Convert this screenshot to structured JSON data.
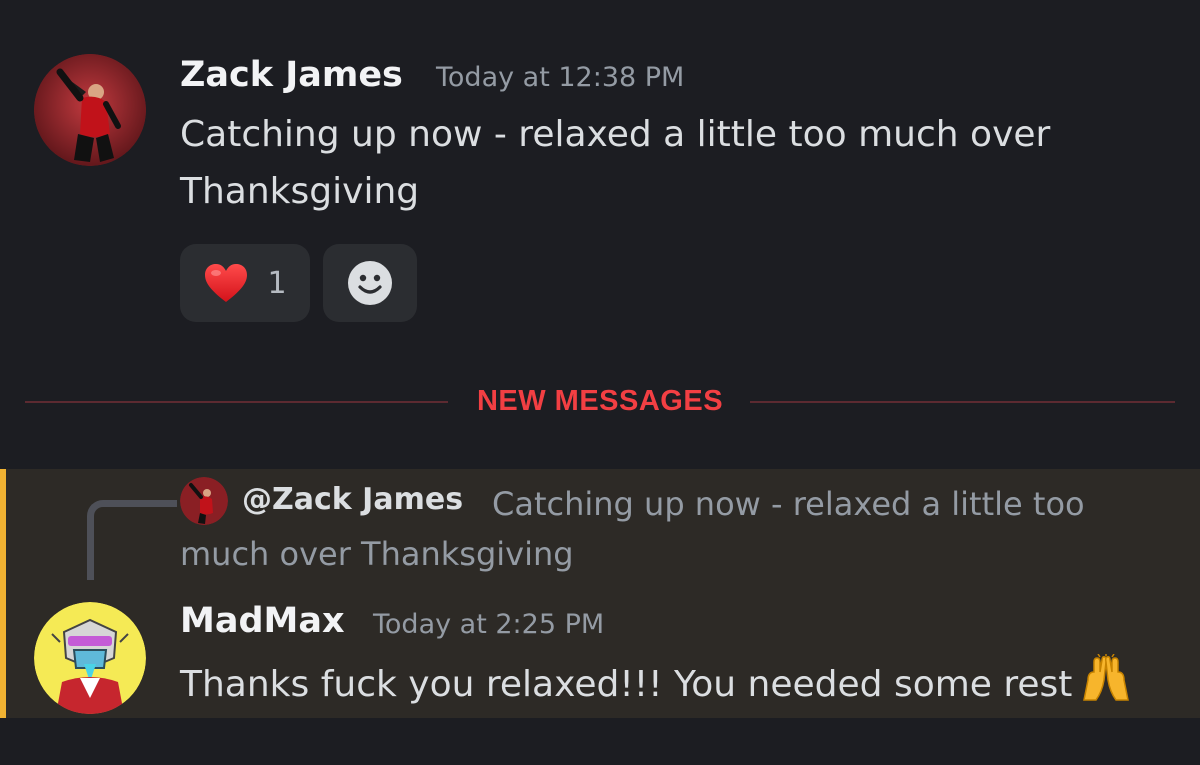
{
  "messages": [
    {
      "author": "Zack James",
      "timestamp": "Today at 12:38 PM",
      "text": "Catching up now - relaxed a little too much over Thanksgiving",
      "reactions": [
        {
          "emoji": "heart",
          "count": "1"
        },
        {
          "emoji": "add-reaction"
        }
      ]
    },
    {
      "author": "MadMax",
      "timestamp": "Today at 2:25 PM",
      "text": "Thanks fuck you relaxed!!! You needed some rest",
      "trailing_emoji": "raising-hands",
      "reply_to": {
        "author": "@Zack James",
        "preview": "Catching up now - relaxed a little too much over Thanksgiving"
      }
    }
  ],
  "divider": {
    "label": "NEW MESSAGES"
  },
  "colors": {
    "background": "#1c1d22",
    "new_messages_red": "#f23f43",
    "highlight_bar": "#f0b232",
    "highlight_bg": "#2d2a26"
  }
}
